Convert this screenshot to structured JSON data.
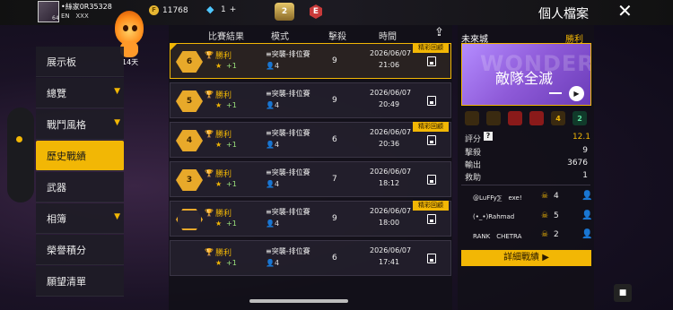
{
  "header": {
    "player_name": "•絲家0R35328",
    "region": "EN",
    "region_code": "XXX",
    "coins": "11768",
    "diamonds": "1",
    "diamond_plus": "+",
    "rank_badge": "2",
    "e_badge": "E",
    "page_title": "個人檔案",
    "avatar_level": "64"
  },
  "mascot": {
    "days": "14天"
  },
  "sidebar": {
    "items": [
      {
        "label": "展示板",
        "chevron": false,
        "active": false
      },
      {
        "label": "總覽",
        "chevron": true,
        "active": false
      },
      {
        "label": "戰鬥風格",
        "chevron": true,
        "active": false
      },
      {
        "label": "歷史戰績",
        "chevron": false,
        "active": true
      },
      {
        "label": "武器",
        "chevron": false,
        "active": false
      },
      {
        "label": "相簿",
        "chevron": true,
        "active": false
      },
      {
        "label": "榮譽積分",
        "chevron": false,
        "active": false
      },
      {
        "label": "願望清單",
        "chevron": false,
        "active": false
      }
    ]
  },
  "table": {
    "headers": [
      "比賽結果",
      "模式",
      "擊殺",
      "時間"
    ],
    "rows": [
      {
        "rank": "6",
        "result": "勝利",
        "stars": "+1",
        "mode": "≡突襲-排位賽",
        "squad": "4",
        "kills": "9",
        "date": "2026/06/07",
        "time": "21:06",
        "highlight": "精彩回顧",
        "selected": true
      },
      {
        "rank": "5",
        "result": "勝利",
        "stars": "+1",
        "mode": "≡突襲-排位賽",
        "squad": "4",
        "kills": "9",
        "date": "2026/06/07",
        "time": "20:49",
        "highlight": "",
        "selected": false
      },
      {
        "rank": "4",
        "result": "勝利",
        "stars": "+1",
        "mode": "≡突襲-排位賽",
        "squad": "4",
        "kills": "6",
        "date": "2026/06/07",
        "time": "20:36",
        "highlight": "精彩回顧",
        "selected": false
      },
      {
        "rank": "3",
        "result": "勝利",
        "stars": "+1",
        "mode": "≡突襲-排位賽",
        "squad": "4",
        "kills": "7",
        "date": "2026/06/07",
        "time": "18:12",
        "highlight": "",
        "selected": false
      },
      {
        "rank": "",
        "result": "勝利",
        "stars": "+1",
        "mode": "≡突襲-排位賽",
        "squad": "4",
        "kills": "9",
        "date": "2026/06/07",
        "time": "18:00",
        "highlight": "精彩回顧",
        "selected": false
      },
      {
        "rank": "",
        "result": "勝利",
        "stars": "+1",
        "mode": "≡突襲-排位賽",
        "squad": "4",
        "kills": "6",
        "date": "2026/06/07",
        "time": "17:41",
        "highlight": "",
        "selected": false
      }
    ]
  },
  "detail": {
    "map": "未來城",
    "result": "勝利",
    "banner_bg_text": "WONDERLY",
    "banner": "敵隊全滅",
    "medals": [
      "",
      "",
      "",
      "",
      "4",
      "2"
    ],
    "score_label": "評分",
    "score_value": "12.1",
    "stats": [
      {
        "label": "擊殺",
        "value": "9"
      },
      {
        "label": "輸出",
        "value": "3676"
      },
      {
        "label": "救助",
        "value": "1"
      }
    ],
    "players": [
      {
        "name": "@LuFFy⅀　exe!",
        "kills": "4"
      },
      {
        "name": "(•_•)Rahmad",
        "kills": "5"
      },
      {
        "name": "RANK　CHETRA",
        "kills": "2"
      }
    ],
    "button": "詳細戰績 ▶"
  }
}
